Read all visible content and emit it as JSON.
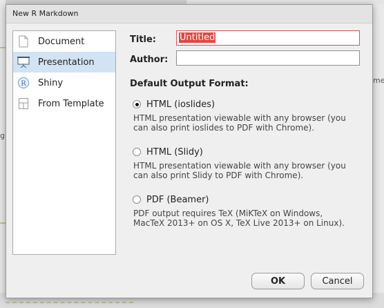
{
  "window": {
    "title": "New R Markdown"
  },
  "sidebar": {
    "items": [
      {
        "label": "Document",
        "icon": "document-icon",
        "selected": false
      },
      {
        "label": "Presentation",
        "icon": "presentation-icon",
        "selected": true
      },
      {
        "label": "Shiny",
        "icon": "shiny-icon",
        "selected": false
      },
      {
        "label": "From Template",
        "icon": "template-icon",
        "selected": false
      }
    ]
  },
  "form": {
    "title_label": "Title:",
    "title_value": "Untitled",
    "author_label": "Author:",
    "author_value": ""
  },
  "output": {
    "heading": "Default Output Format:",
    "options": [
      {
        "label": "HTML (ioslides)",
        "checked": true,
        "desc1": "HTML presentation viewable with any browser (you",
        "desc2": "can also print ioslides to PDF with Chrome)."
      },
      {
        "label": "HTML (Slidy)",
        "checked": false,
        "desc1": "HTML presentation viewable with any browser (you",
        "desc2": "can also print Slidy to PDF with Chrome)."
      },
      {
        "label": "PDF (Beamer)",
        "checked": false,
        "desc1": "PDF output requires TeX (MiKTeX on Windows,",
        "desc2": "MacTeX 2013+ on OS X, TeX Live 2013+ on Linux)."
      }
    ]
  },
  "buttons": {
    "ok": "OK",
    "cancel": "Cancel"
  },
  "background": {
    "frag_g": "g",
    "frag_me": "me"
  },
  "colors": {
    "accent": "#e0473f",
    "selection": "#d2e3f3"
  }
}
